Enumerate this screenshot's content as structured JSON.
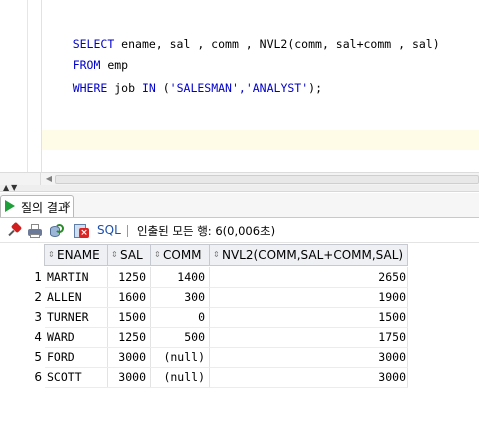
{
  "editor": {
    "lines": [
      {
        "kw1": "SELECT",
        "rest": " ename, sal , comm , NVL2(comm, sal+comm , sal)"
      },
      {
        "kw1": "FROM",
        "rest": " emp"
      },
      {
        "kw1": "WHERE",
        "mid1": " job ",
        "kw2": "IN",
        "rest": " (",
        "str": "'SALESMAN','ANALYST'",
        "end": ");"
      }
    ]
  },
  "splitter": {
    "arrows": "▲▼"
  },
  "hscroll": {
    "left_arrow": "◀"
  },
  "results_tab": {
    "label": "질의 결과",
    "close": "✕"
  },
  "toolbar": {
    "sql_link": "SQL",
    "status": "인출된 모든 행: 6(0,006초)"
  },
  "grid": {
    "sort_glyph": "⇕",
    "columns": [
      "ENAME",
      "SAL",
      "COMM",
      "NVL2(COMM,SAL+COMM,SAL)"
    ],
    "rows": [
      {
        "num": "1",
        "ename": "MARTIN",
        "sal": "1250",
        "comm": "1400",
        "nvl": "2650"
      },
      {
        "num": "2",
        "ename": "ALLEN",
        "sal": "1600",
        "comm": "300",
        "nvl": "1900"
      },
      {
        "num": "3",
        "ename": "TURNER",
        "sal": "1500",
        "comm": "0",
        "nvl": "1500"
      },
      {
        "num": "4",
        "ename": "WARD",
        "sal": "1250",
        "comm": "500",
        "nvl": "1750"
      },
      {
        "num": "5",
        "ename": "FORD",
        "sal": "3000",
        "comm": "(null)",
        "nvl": "3000"
      },
      {
        "num": "6",
        "ename": "SCOTT",
        "sal": "3000",
        "comm": "(null)",
        "nvl": "3000"
      }
    ]
  },
  "colors": {
    "keyword": "#0000cc",
    "run_icon": "#1f9f3a",
    "sql_link": "#1b4fae"
  }
}
